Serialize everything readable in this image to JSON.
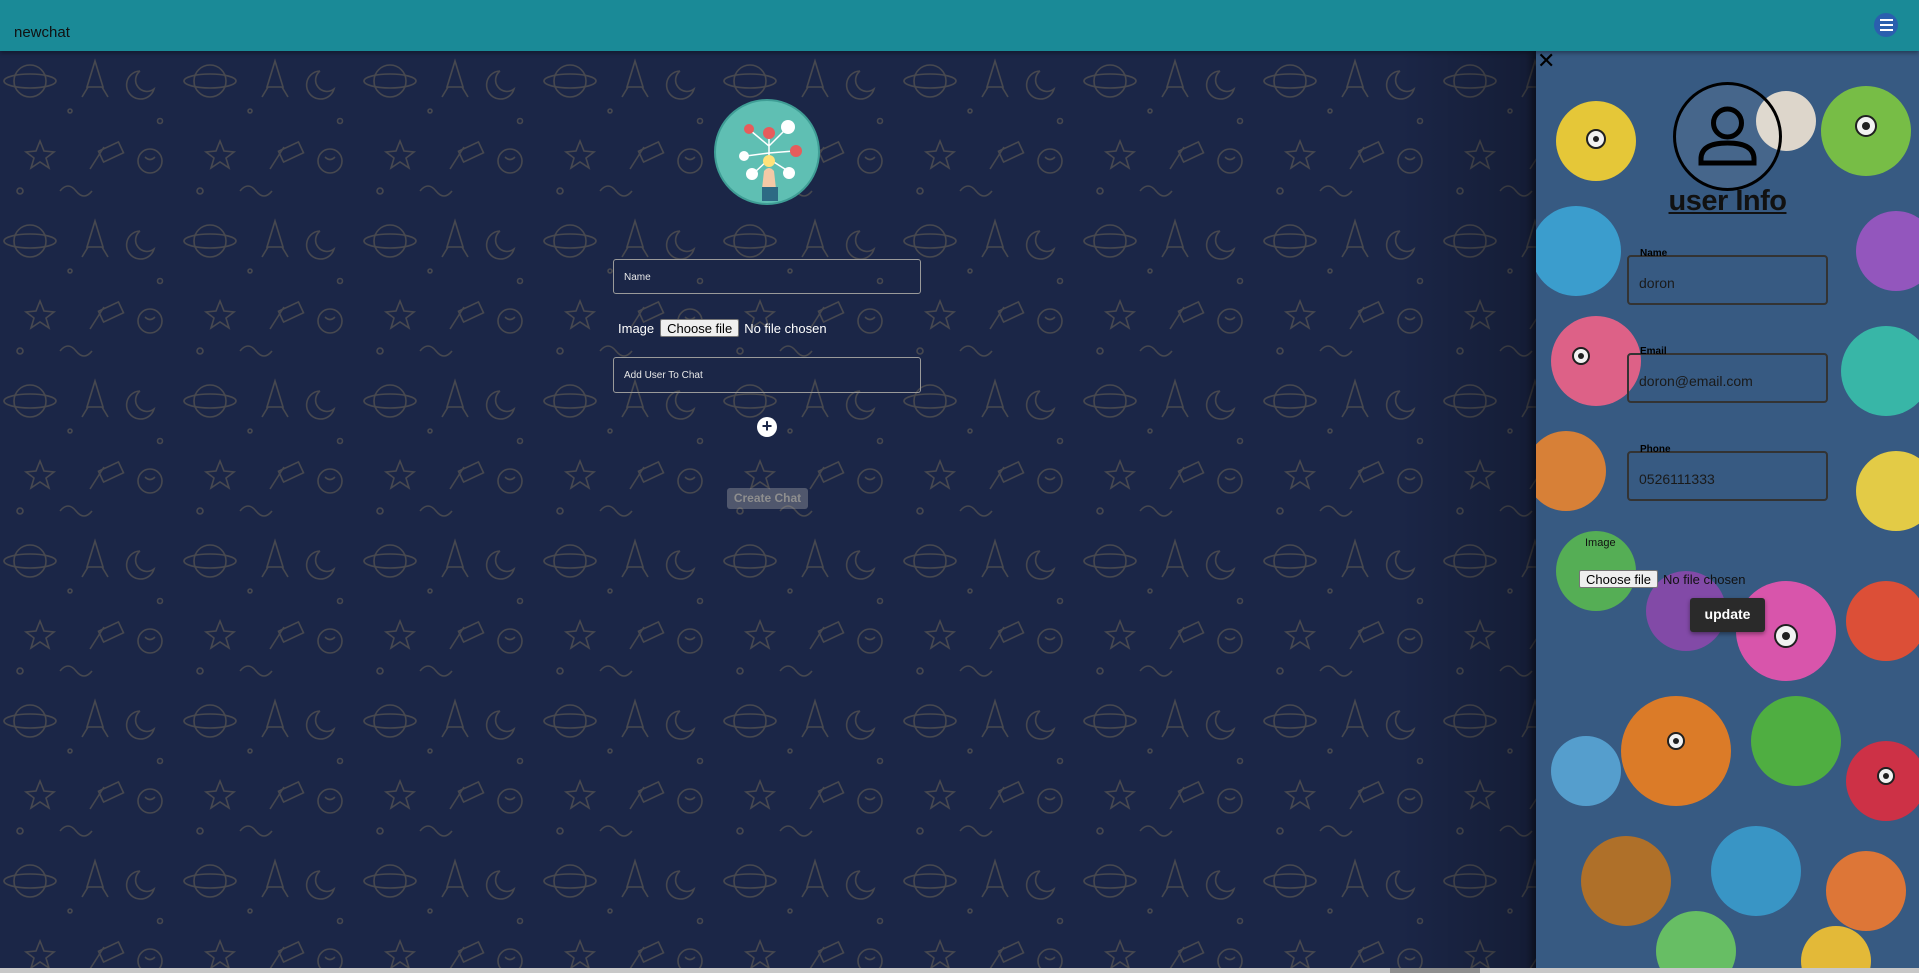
{
  "appbar": {
    "title": "newchat",
    "menu_icon": "hamburger-menu-icon"
  },
  "new_chat_form": {
    "logo_icon": "network-hand-logo",
    "name_placeholder": "Name",
    "image_label": "Image",
    "choose_file_label": "Choose file",
    "no_file_text": "No file chosen",
    "add_user_placeholder": "Add User To Chat",
    "add_button_icon": "plus-circle-icon",
    "add_button_glyph": "+",
    "create_button_label": "Create Chat"
  },
  "user_info": {
    "close_icon": "close-icon",
    "close_glyph": "✕",
    "avatar_icon": "person-icon",
    "title": "user Info",
    "name_label": "Name",
    "name_value": "doron",
    "email_label": "Email",
    "email_value": "doron@email.com",
    "phone_label": "Phone",
    "phone_value": "0526111333",
    "image_label": "Image",
    "choose_file_label": "Choose file",
    "no_file_text": "No file chosen",
    "update_label": "update"
  },
  "colors": {
    "appbar": "#1a8a97",
    "background": "#1b2647",
    "pattern": "#5d5a55",
    "update_button": "#2a2a2a"
  }
}
